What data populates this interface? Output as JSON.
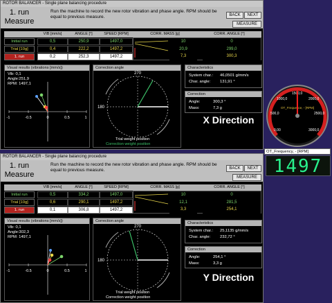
{
  "panels": [
    {
      "titlebar": "ROTOR BALANCER - Single plane balancing procedure",
      "run_title": "1. run\nMeasure",
      "instruction": "Run the machine to record the new rotor vibration and phase angle. RPM should be equal to previous measure.",
      "buttons": {
        "back": "BACK",
        "next": "NEXT",
        "measure": "MEASURE"
      },
      "table": {
        "headers": [
          "VIB [mm/s]",
          "ANGLE [°]",
          "SPEED [RPM]",
          "CORR. MASS [g]",
          "CORR. ANGLE [°]"
        ],
        "rows": [
          {
            "label": "Initial run",
            "vib": "0,5",
            "angle": "250,9",
            "speed": "1497,0"
          },
          {
            "label": "Trial [10g]",
            "vib": "0,4",
            "angle": "222,2",
            "speed": "1497,2"
          },
          {
            "label": "1. run",
            "vib": "0,2",
            "angle": "252,3",
            "speed": "1497,2"
          }
        ],
        "corr_rows": [
          {
            "mass": "10",
            "angle": "0"
          },
          {
            "mass": "20,9",
            "angle": "299,0"
          },
          {
            "mass": "7,3",
            "angle": "300,3"
          }
        ]
      },
      "visual": {
        "title": "Visual results (vibrations [mm/s])",
        "vib": "Vib:   0,1",
        "angle": "Angle:251,9",
        "rpm": "RPM: 1497,1",
        "ticks": [
          "-1",
          "-0.5",
          "0",
          "0.5",
          "1"
        ]
      },
      "correction_angle": {
        "title": "Correction angle",
        "tick_top": "270",
        "tick_left": "180",
        "caption_1": "Trial weight position",
        "caption_2": "Correction weight position"
      },
      "characteristics": {
        "title": "Characteristics",
        "system_label": "System char.:",
        "system_value": "46,0501 g/mm/s",
        "angle_label": "Char. angle:",
        "angle_value": "131,91 °"
      },
      "correction": {
        "title": "Correction",
        "angle_label": "Angle:",
        "angle_value": "300,3 °",
        "mass_label": "Mass:",
        "mass_value": "7,3 g"
      },
      "direction": "X Direction"
    },
    {
      "titlebar": "ROTOR BALANCER - Single plane balancing procedure",
      "run_title": "1. run\nMeasure",
      "instruction": "Run the machine to record the new rotor vibration and phase angle. RPM should be equal to previous measure.",
      "buttons": {
        "back": "BACK",
        "next": "NEXT",
        "measure": "MEASURE"
      },
      "table": {
        "headers": [
          "VIB [mm/s]",
          "ANGLE [°]",
          "SPEED [RPM]",
          "CORR. MASS [g]",
          "CORR. ANGLE [°]"
        ],
        "rows": [
          {
            "label": "Initial run",
            "vib": "0,5",
            "angle": "334,2",
            "speed": "1497,0"
          },
          {
            "label": "Trial [10g]",
            "vib": "0,6",
            "angle": "290,1",
            "speed": "1497,2"
          },
          {
            "label": "1. run",
            "vib": "0,1",
            "angle": "306,8",
            "speed": "1497,2"
          }
        ],
        "corr_rows": [
          {
            "mass": "10",
            "angle": "0"
          },
          {
            "mass": "12,1",
            "angle": "281,5"
          },
          {
            "mass": "3,3",
            "angle": "254,1"
          }
        ]
      },
      "visual": {
        "title": "Visual results (vibrations [mm/s])",
        "vib": "Vib:   0,1",
        "angle": "Angle:302,3",
        "rpm": "RPM: 1497,1",
        "ticks": [
          "-1",
          "-0.5",
          "0",
          "0.5",
          "1"
        ]
      },
      "correction_angle": {
        "title": "Correction angle",
        "tick_top": "270",
        "tick_left": "180",
        "caption_1": "Trial weight position",
        "caption_2": "Correction weight position"
      },
      "characteristics": {
        "title": "Characteristics",
        "system_label": "System char.:",
        "system_value": "25,1135 g/mm/s",
        "angle_label": "Char. angle:",
        "angle_value": "232,72 °"
      },
      "correction": {
        "title": "Correction",
        "angle_label": "Angle:",
        "angle_value": "254,1 °",
        "mass_label": "Mass:",
        "mass_value": "3,3 g"
      },
      "direction": "Y Direction"
    }
  ],
  "gauge": {
    "ticks": [
      "0,00",
      "500,0",
      "1000,0",
      "1500,0",
      "2000,0",
      "2500,0",
      "3000,0"
    ],
    "label": "OT_Frequence, - [RPM]",
    "value": 1497
  },
  "freq": {
    "title": "OT_Frequency, - [RPM]",
    "display": "1497"
  },
  "colors": {
    "initial": "#7cd46b",
    "trial": "#e8d64a",
    "run": "#ff4040",
    "correction": "#3cc068",
    "white_vec": "#ffffff"
  }
}
